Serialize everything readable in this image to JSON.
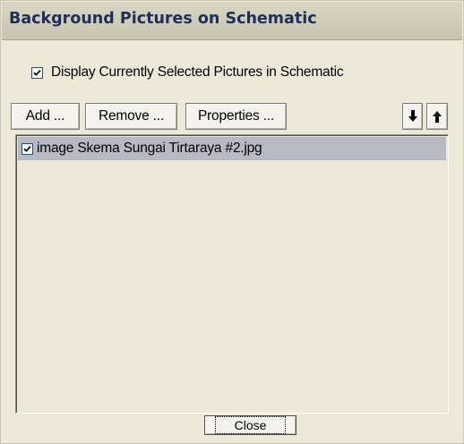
{
  "window": {
    "title": "Background Pictures on Schematic"
  },
  "display_option": {
    "label": "Display Currently Selected Pictures in Schematic",
    "checked": true
  },
  "toolbar": {
    "add_label": "Add ...",
    "remove_label": "Remove ...",
    "properties_label": "Properties ...",
    "move_down_icon": "arrow-down-icon",
    "move_up_icon": "arrow-up-icon"
  },
  "pictures": [
    {
      "label": "image Skema Sungai Tirtaraya #2.jpg",
      "checked": true,
      "selected": true
    }
  ],
  "footer": {
    "close_label": "Close"
  },
  "colors": {
    "dialog_bg": "#ece9d8",
    "title_text": "#1f2f56",
    "selection": "#b9b9c6"
  }
}
